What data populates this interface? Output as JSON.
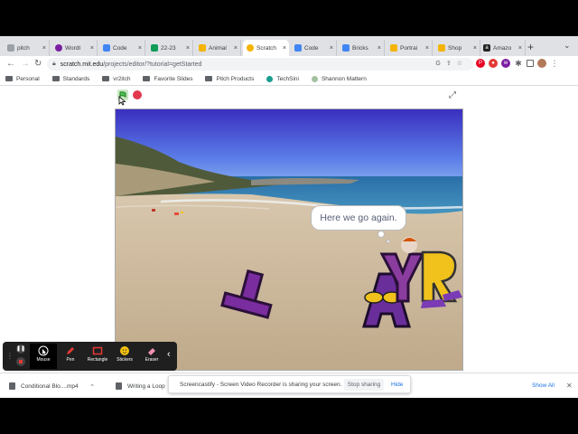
{
  "browser": {
    "tabs": [
      {
        "label": "pitch",
        "color": "#9aa0a6"
      },
      {
        "label": "Wordt",
        "color": "#7b1fa2"
      },
      {
        "label": "Code",
        "color": "#4285f4"
      },
      {
        "label": "22-23",
        "color": "#0f9d58"
      },
      {
        "label": "Animal",
        "color": "#f4b400"
      },
      {
        "label": "Scratch",
        "color": "#f4b400",
        "active": true
      },
      {
        "label": "Code",
        "color": "#4285f4"
      },
      {
        "label": "Bricks",
        "color": "#4285f4"
      },
      {
        "label": "Portrai",
        "color": "#f4b400"
      },
      {
        "label": "Shop",
        "color": "#f4b400"
      },
      {
        "label": "Amazo",
        "color": "#222222"
      }
    ],
    "url_host": "scratch.mit.edu",
    "url_path": "/projects/editor/?tutorial=getStarted",
    "bookmarks": [
      {
        "label": "Personal",
        "type": "folder"
      },
      {
        "label": "Standards",
        "type": "folder"
      },
      {
        "label": "vr2itch",
        "type": "folder"
      },
      {
        "label": "Favorite Slides",
        "type": "folder"
      },
      {
        "label": "Pitch Products",
        "type": "folder"
      },
      {
        "label": "TechSini",
        "type": "site",
        "color": "#1a9e8f"
      },
      {
        "label": "Shannon Mattern",
        "type": "site",
        "color": "#a3c1a0"
      }
    ]
  },
  "stage": {
    "speech_bubble": "Here we go again."
  },
  "screencastify_toolbar": {
    "tools": [
      {
        "label": "Mouse",
        "icon": "cursor-icon",
        "active": true
      },
      {
        "label": "Pen",
        "icon": "pen-icon"
      },
      {
        "label": "Rectangle",
        "icon": "rectangle-icon"
      },
      {
        "label": "Stickers",
        "icon": "sticker-icon"
      },
      {
        "label": "Eraser",
        "icon": "eraser-icon"
      }
    ]
  },
  "downloads": {
    "items": [
      "Conditional Blo....mp4",
      "Writing a Loop"
    ],
    "show_all": "Show All"
  },
  "share_notice": {
    "message": "Screencastify - Screen Video Recorder is sharing your screen.",
    "stop_label": "Stop sharing",
    "hide_label": "Hide"
  }
}
